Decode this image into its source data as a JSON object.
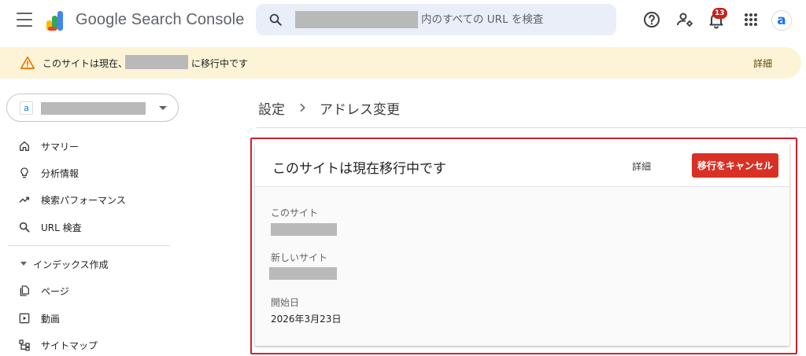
{
  "app": {
    "product_name": "Google Search Console"
  },
  "search": {
    "placeholder": "内のすべての URL を検査"
  },
  "topbar": {
    "notification_count": "13",
    "avatar_letter": "a"
  },
  "banner": {
    "text_before": "このサイトは現在、",
    "text_after": "に移行中です",
    "details_label": "詳細"
  },
  "sidebar": {
    "property_favicon": "a",
    "items": [
      {
        "label": "サマリー",
        "icon": "home-icon"
      },
      {
        "label": "分析情報",
        "icon": "lightbulb-icon"
      },
      {
        "label": "検索パフォーマンス",
        "icon": "trending-up-icon"
      },
      {
        "label": "URL 検査",
        "icon": "search-icon"
      }
    ],
    "section_label": "インデックス作成",
    "section_items": [
      {
        "label": "ページ",
        "icon": "pages-icon"
      },
      {
        "label": "動画",
        "icon": "video-icon"
      },
      {
        "label": "サイトマップ",
        "icon": "sitemap-icon"
      }
    ]
  },
  "breadcrumb": {
    "parent": "設定",
    "current": "アドレス変更"
  },
  "card": {
    "title": "このサイトは現在移行中です",
    "details_label": "詳細",
    "cancel_label": "移行をキャンセル",
    "this_site_label": "このサイト",
    "new_site_label": "新しいサイト",
    "start_date_label": "開始日",
    "start_date_value": "2026年3月23日"
  },
  "colors": {
    "accent_red": "#d93025",
    "highlight_border": "#d0202e",
    "banner_bg": "#fdf4d7",
    "search_bg": "#e9eef9"
  }
}
